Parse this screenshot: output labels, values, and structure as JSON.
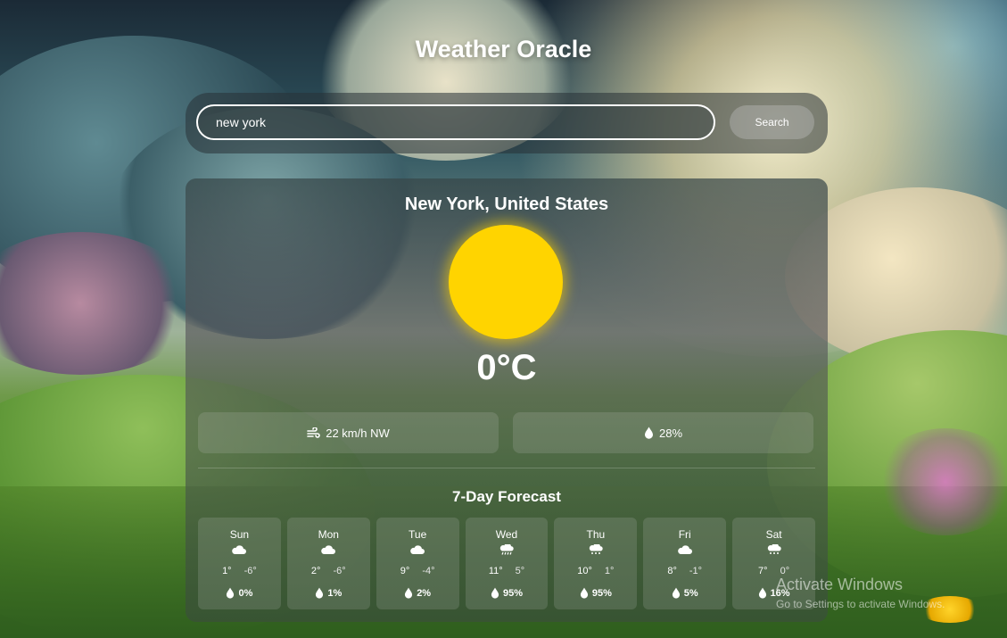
{
  "app": {
    "title": "Weather Oracle"
  },
  "search": {
    "value": "new york",
    "button_label": "Search"
  },
  "current": {
    "location": "New York, United States",
    "condition_icon": "sun-icon",
    "temperature": "0°C",
    "wind": "22 km/h NW",
    "humidity": "28%"
  },
  "forecast": {
    "title": "7-Day Forecast",
    "days": [
      {
        "day": "Sun",
        "icon": "cloud-icon",
        "high": "1°",
        "low": "-6°",
        "precip": "0%"
      },
      {
        "day": "Mon",
        "icon": "cloud-icon",
        "high": "2°",
        "low": "-6°",
        "precip": "1%"
      },
      {
        "day": "Tue",
        "icon": "cloud-icon",
        "high": "9°",
        "low": "-4°",
        "precip": "2%"
      },
      {
        "day": "Wed",
        "icon": "cloud-rain-icon",
        "high": "11°",
        "low": "5°",
        "precip": "95%"
      },
      {
        "day": "Thu",
        "icon": "cloud-snow-icon",
        "high": "10°",
        "low": "1°",
        "precip": "95%"
      },
      {
        "day": "Fri",
        "icon": "cloud-icon",
        "high": "8°",
        "low": "-1°",
        "precip": "5%"
      },
      {
        "day": "Sat",
        "icon": "cloud-snow-icon",
        "high": "7°",
        "low": "0°",
        "precip": "16%"
      }
    ]
  },
  "watermark": {
    "line1": "Activate Windows",
    "line2": "Go to Settings to activate Windows."
  },
  "colors": {
    "sun": "#ffd400",
    "text": "#ffffff"
  }
}
